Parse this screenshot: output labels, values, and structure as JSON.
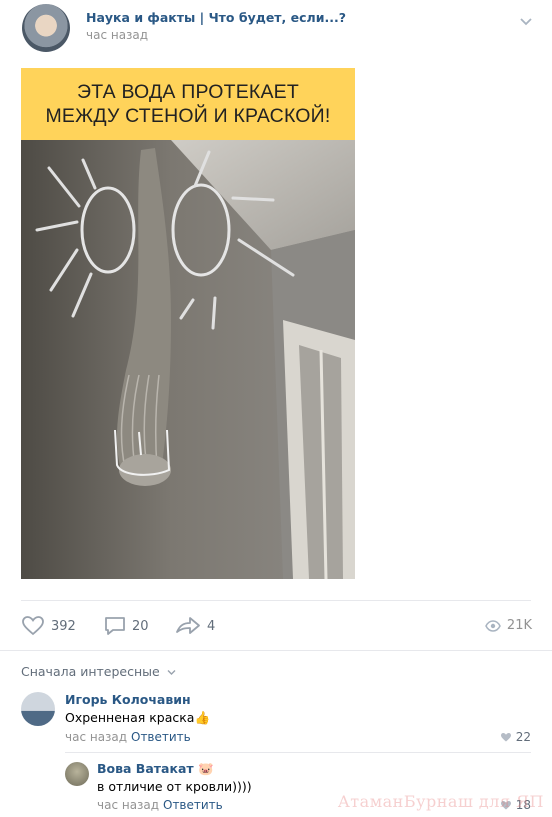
{
  "post": {
    "group_name": "Наука и факты | Что будет, если...?",
    "time": "час назад",
    "banner_line1": "ЭТА ВОДА ПРОТЕКАЕТ",
    "banner_line2": "МЕЖДУ СТЕНОЙ И КРАСКОЙ!"
  },
  "actions": {
    "likes": "392",
    "comments": "20",
    "shares": "4",
    "views": "21K"
  },
  "comments_section": {
    "sort_label": "Сначала интересные"
  },
  "comments": [
    {
      "author": "Игорь Колочавин",
      "text": "Охренненая краска",
      "emoji": "👍",
      "time": "час назад",
      "reply_label": "Ответить",
      "likes": "22"
    },
    {
      "author": "Вова Ватакат",
      "author_emoji": "🐷",
      "text": "в отличие от кровли))))",
      "time": "час назад",
      "reply_label": "Ответить",
      "likes": "18"
    }
  ],
  "watermark": "АтаманБурнаш для ЯП",
  "colors": {
    "link": "#2a5885",
    "meta": "#939393",
    "banner": "#ffd35a"
  },
  "icons": [
    "chevron-down-icon",
    "heart-icon",
    "comment-icon",
    "share-icon",
    "eye-icon"
  ]
}
